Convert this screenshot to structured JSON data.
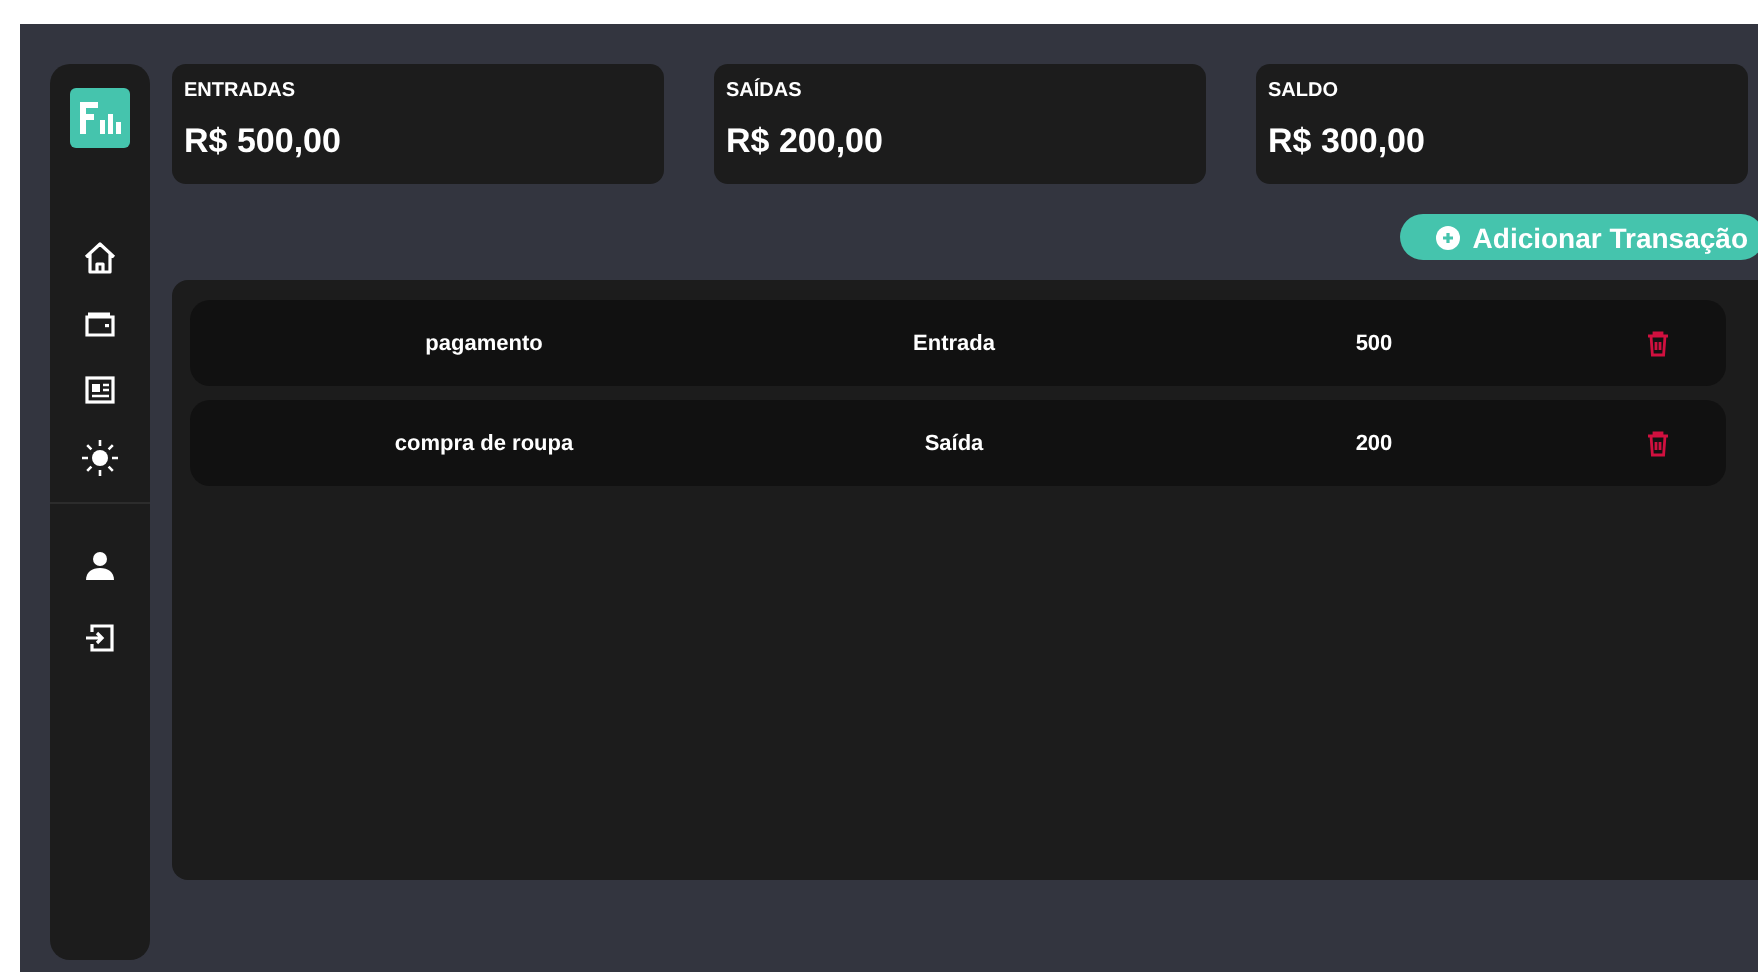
{
  "summary_cards": [
    {
      "label": "ENTRADAS",
      "amount": "R$ 500,00"
    },
    {
      "label": "SAÍDAS",
      "amount": "R$ 200,00"
    },
    {
      "label": "SALDO",
      "amount": "R$ 300,00"
    }
  ],
  "add_button": {
    "label": "Adicionar Transação"
  },
  "transactions": [
    {
      "description": "pagamento",
      "type": "Entrada",
      "value": "500"
    },
    {
      "description": "compra de roupa",
      "type": "Saída",
      "value": "200"
    }
  ]
}
